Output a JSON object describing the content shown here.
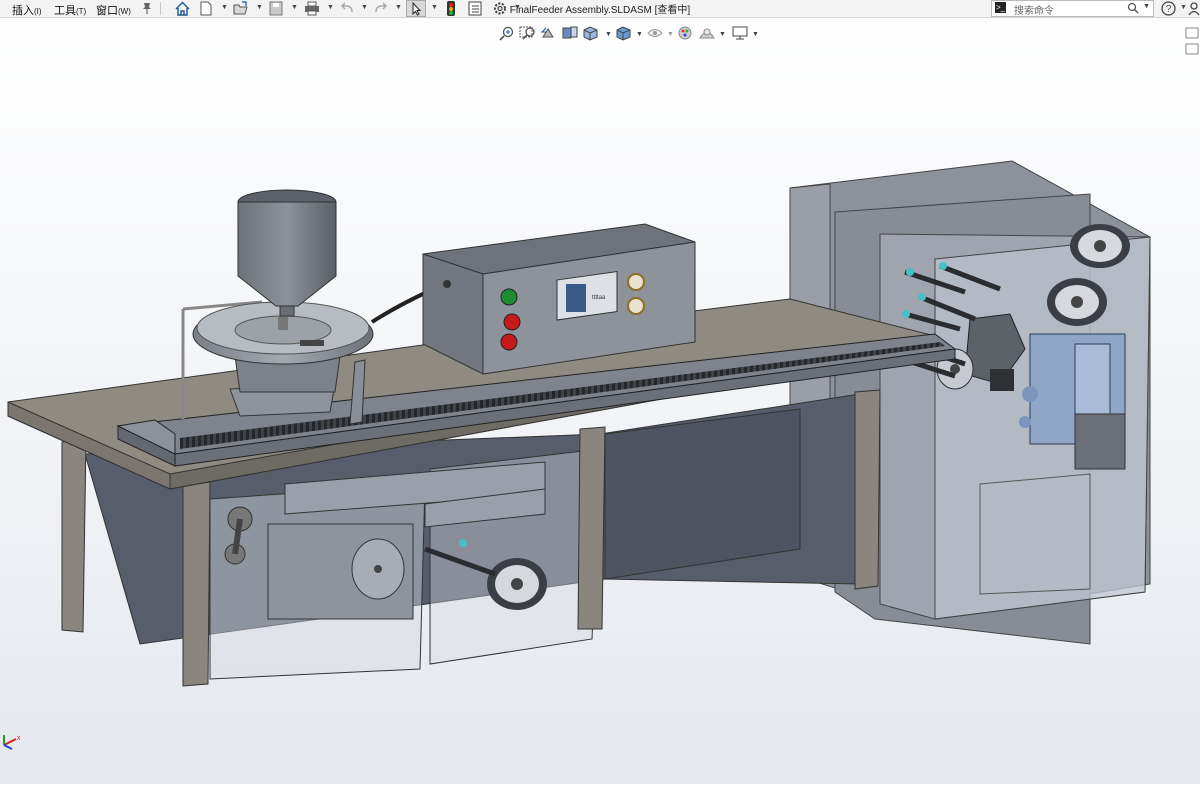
{
  "menubar": {
    "items": [
      {
        "label": "插入",
        "key": "(I)"
      },
      {
        "label": "工具",
        "key": "(T)"
      },
      {
        "label": "窗口",
        "key": "(W)"
      }
    ]
  },
  "window": {
    "title": "FinalFeeder Assembly.SLDASM [查看中]"
  },
  "search": {
    "placeholder": "搜索命令"
  },
  "triad": {
    "x_label": "x"
  },
  "control_box": {
    "brand": "ttttaa"
  },
  "colors": {
    "steel": "#8d939c",
    "steel_dark": "#5c616b",
    "table_top": "#8f8a82",
    "frame_dark": "#575d6b",
    "button_green": "#1d8c33",
    "button_red": "#c61a1a",
    "accent_blue": "#2255aa"
  },
  "icons": [
    "home-icon",
    "new-document-icon",
    "open-folder-icon",
    "save-icon",
    "print-icon",
    "undo-icon",
    "redo-icon",
    "select-cursor-icon",
    "traffic-light-icon",
    "file-properties-icon",
    "options-gear-icon",
    "search-icon",
    "help-icon",
    "user-icon",
    "pin-icon",
    "zoom-to-fit-icon",
    "zoom-to-area-icon",
    "previous-view-icon",
    "section-view-icon",
    "view-orientation-icon",
    "display-style-icon",
    "hide-show-icon",
    "edit-appearance-icon",
    "apply-scene-icon",
    "view-settings-icon",
    "coordinate-triad-icon"
  ]
}
